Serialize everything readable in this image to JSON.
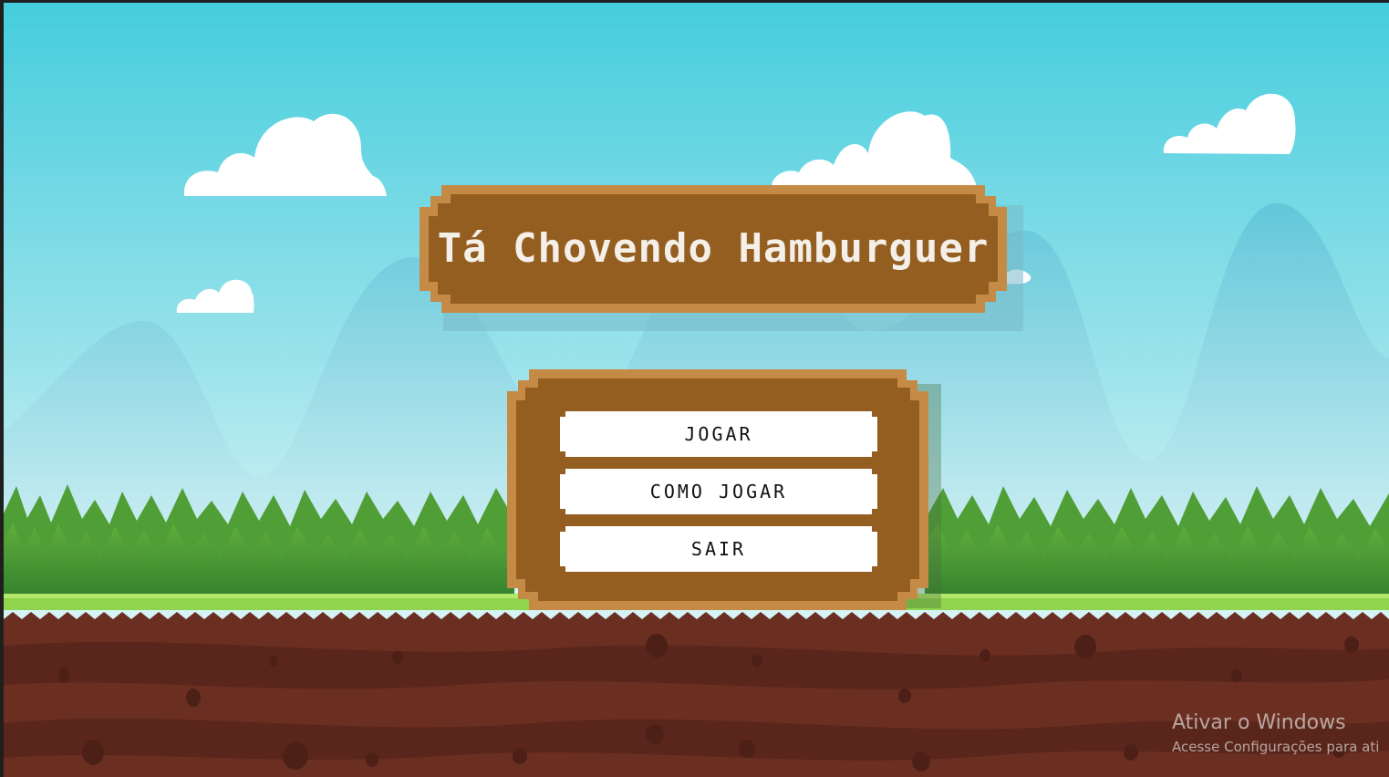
{
  "game": {
    "title": "Tá Chovendo Hamburguer"
  },
  "menu": {
    "buttons": [
      {
        "id": "play",
        "label": "JOGAR"
      },
      {
        "id": "how-to-play",
        "label": "COMO JOGAR"
      },
      {
        "id": "exit",
        "label": "SAIR"
      }
    ]
  },
  "watermark": {
    "title": "Ativar o Windows",
    "subtitle": "Acesse Configurações para ati"
  },
  "colors": {
    "sky_top": "#49cfdf",
    "sky_bottom": "#d9f5f7",
    "mountain": "#6fcbdc",
    "grass_dark": "#3f8c33",
    "grass_light": "#8fd44c",
    "dirt": "#6b2f22",
    "sign_frame": "#c58a45",
    "sign_fill": "#935e20",
    "title_text": "#f4efe8",
    "button_fill": "#ffffff",
    "button_text": "#111111"
  }
}
